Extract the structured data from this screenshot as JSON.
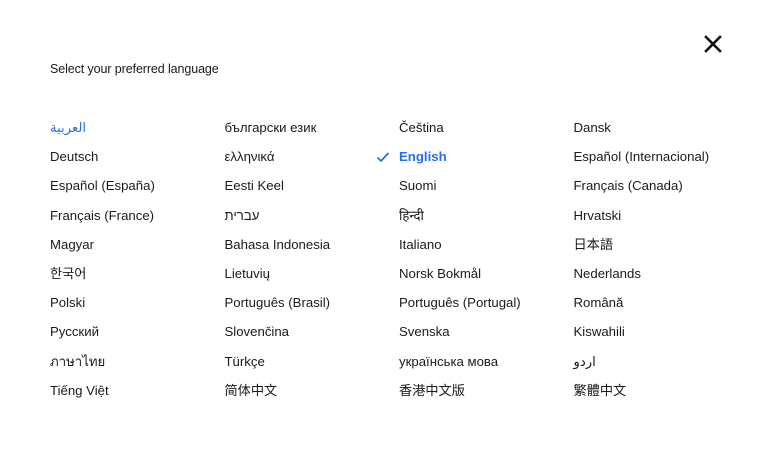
{
  "dialog": {
    "title": "Select your preferred language",
    "close_icon": "close-icon",
    "check_icon": "check-icon",
    "accent_color": "#276ef1"
  },
  "languages": [
    {
      "label": "العربية",
      "state": "link"
    },
    {
      "label": "български език",
      "state": "normal"
    },
    {
      "label": "Čeština",
      "state": "normal"
    },
    {
      "label": "Dansk",
      "state": "normal"
    },
    {
      "label": "Deutsch",
      "state": "normal"
    },
    {
      "label": "ελληνικά",
      "state": "normal"
    },
    {
      "label": "English",
      "state": "selected"
    },
    {
      "label": "Español (Internacional)",
      "state": "normal"
    },
    {
      "label": "Español (España)",
      "state": "normal"
    },
    {
      "label": "Eesti Keel",
      "state": "normal"
    },
    {
      "label": "Suomi",
      "state": "normal"
    },
    {
      "label": "Français (Canada)",
      "state": "normal"
    },
    {
      "label": "Français (France)",
      "state": "normal"
    },
    {
      "label": "עברית",
      "state": "normal"
    },
    {
      "label": "हिन्दी",
      "state": "normal"
    },
    {
      "label": "Hrvatski",
      "state": "normal"
    },
    {
      "label": "Magyar",
      "state": "normal"
    },
    {
      "label": "Bahasa Indonesia",
      "state": "normal"
    },
    {
      "label": "Italiano",
      "state": "normal"
    },
    {
      "label": "日本語",
      "state": "normal"
    },
    {
      "label": "한국어",
      "state": "normal"
    },
    {
      "label": "Lietuvių",
      "state": "normal"
    },
    {
      "label": "Norsk Bokmål",
      "state": "normal"
    },
    {
      "label": "Nederlands",
      "state": "normal"
    },
    {
      "label": "Polski",
      "state": "normal"
    },
    {
      "label": "Português (Brasil)",
      "state": "normal"
    },
    {
      "label": "Português (Portugal)",
      "state": "normal"
    },
    {
      "label": "Română",
      "state": "normal"
    },
    {
      "label": "Русский",
      "state": "normal"
    },
    {
      "label": "Slovenčina",
      "state": "normal"
    },
    {
      "label": "Svenska",
      "state": "normal"
    },
    {
      "label": "Kiswahili",
      "state": "normal"
    },
    {
      "label": "ภาษาไทย",
      "state": "normal"
    },
    {
      "label": "Türkçe",
      "state": "normal"
    },
    {
      "label": "українська мова",
      "state": "normal"
    },
    {
      "label": "اردو",
      "state": "normal"
    },
    {
      "label": "Tiếng Việt",
      "state": "normal"
    },
    {
      "label": "简体中文",
      "state": "normal"
    },
    {
      "label": "香港中文版",
      "state": "normal"
    },
    {
      "label": "繁體中文",
      "state": "normal"
    }
  ]
}
